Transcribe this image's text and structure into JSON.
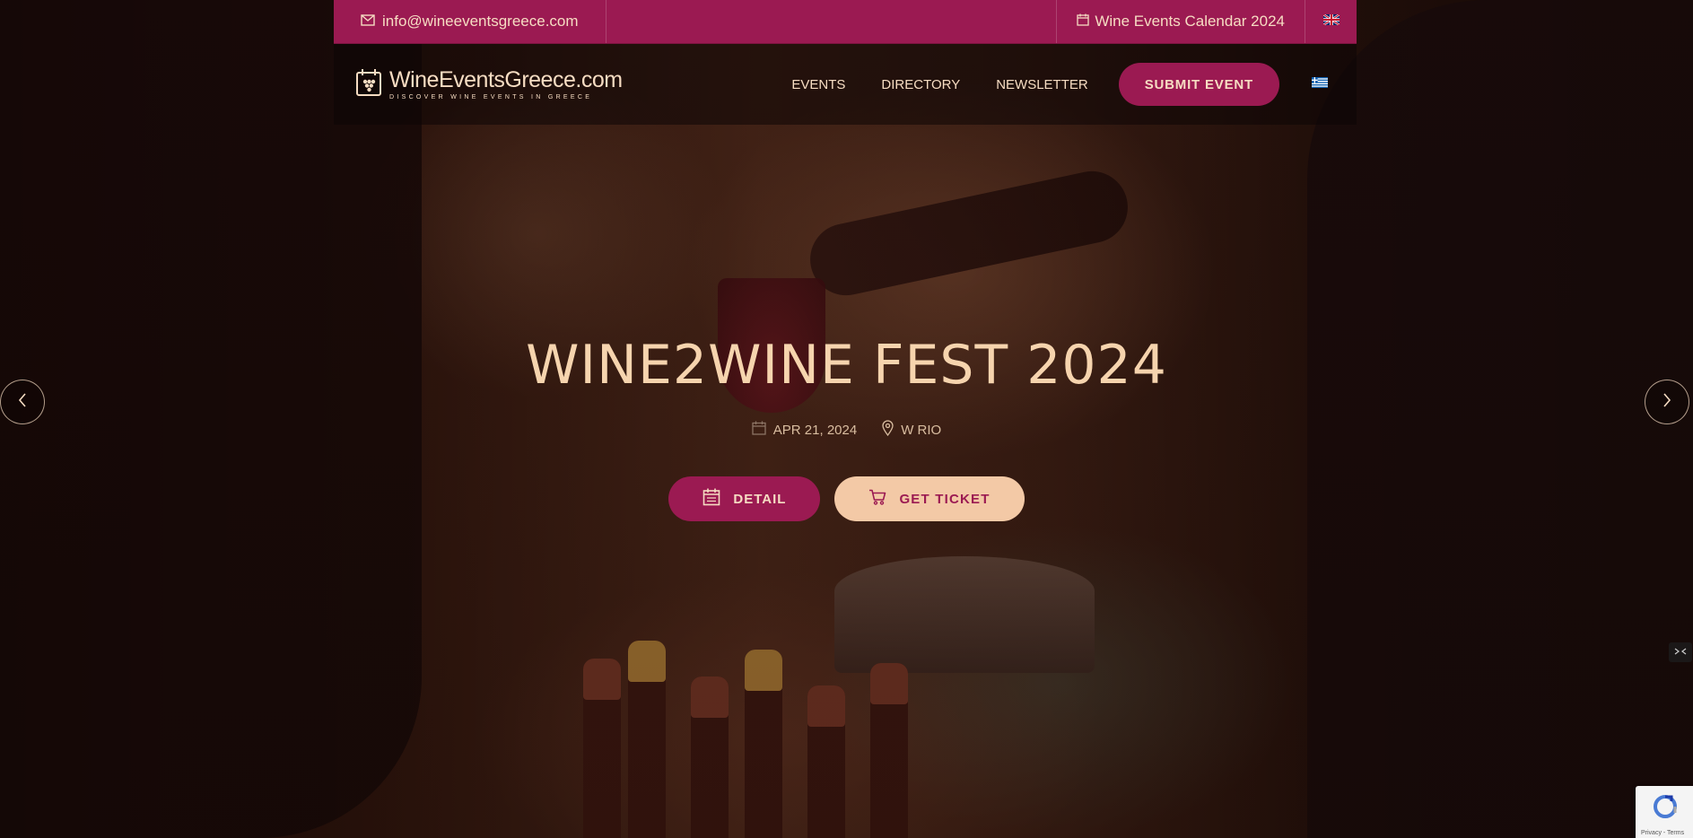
{
  "topbar": {
    "email": "info@wineeventsgreece.com",
    "calendar_link": "Wine Events Calendar 2024",
    "language": "English"
  },
  "navbar": {
    "logo_title": "WineEventsGreece.com",
    "logo_tagline": "DISCOVER WINE EVENTS IN GREECE",
    "links": [
      "EVENTS",
      "DIRECTORY",
      "NEWSLETTER"
    ],
    "submit_label": "SUBMIT EVENT",
    "language": "Greek"
  },
  "hero": {
    "title": "WINE2WINE FEST 2024",
    "date": "APR 21, 2024",
    "location": "W RIO",
    "detail_label": "DETAIL",
    "ticket_label": "GET TICKET"
  },
  "recaptcha": {
    "text": "Privacy - Terms"
  },
  "colors": {
    "brand": "#9b1a52",
    "cream": "#f6dcc2",
    "ticket_bg": "#f3c9a6"
  },
  "icons": [
    "envelope-icon",
    "calendar-icon",
    "uk-flag-icon",
    "greek-flag-icon",
    "calendar-icon",
    "location-pin-icon",
    "cart-icon",
    "chevron-left-icon",
    "chevron-right-icon",
    "recaptcha-icon"
  ]
}
